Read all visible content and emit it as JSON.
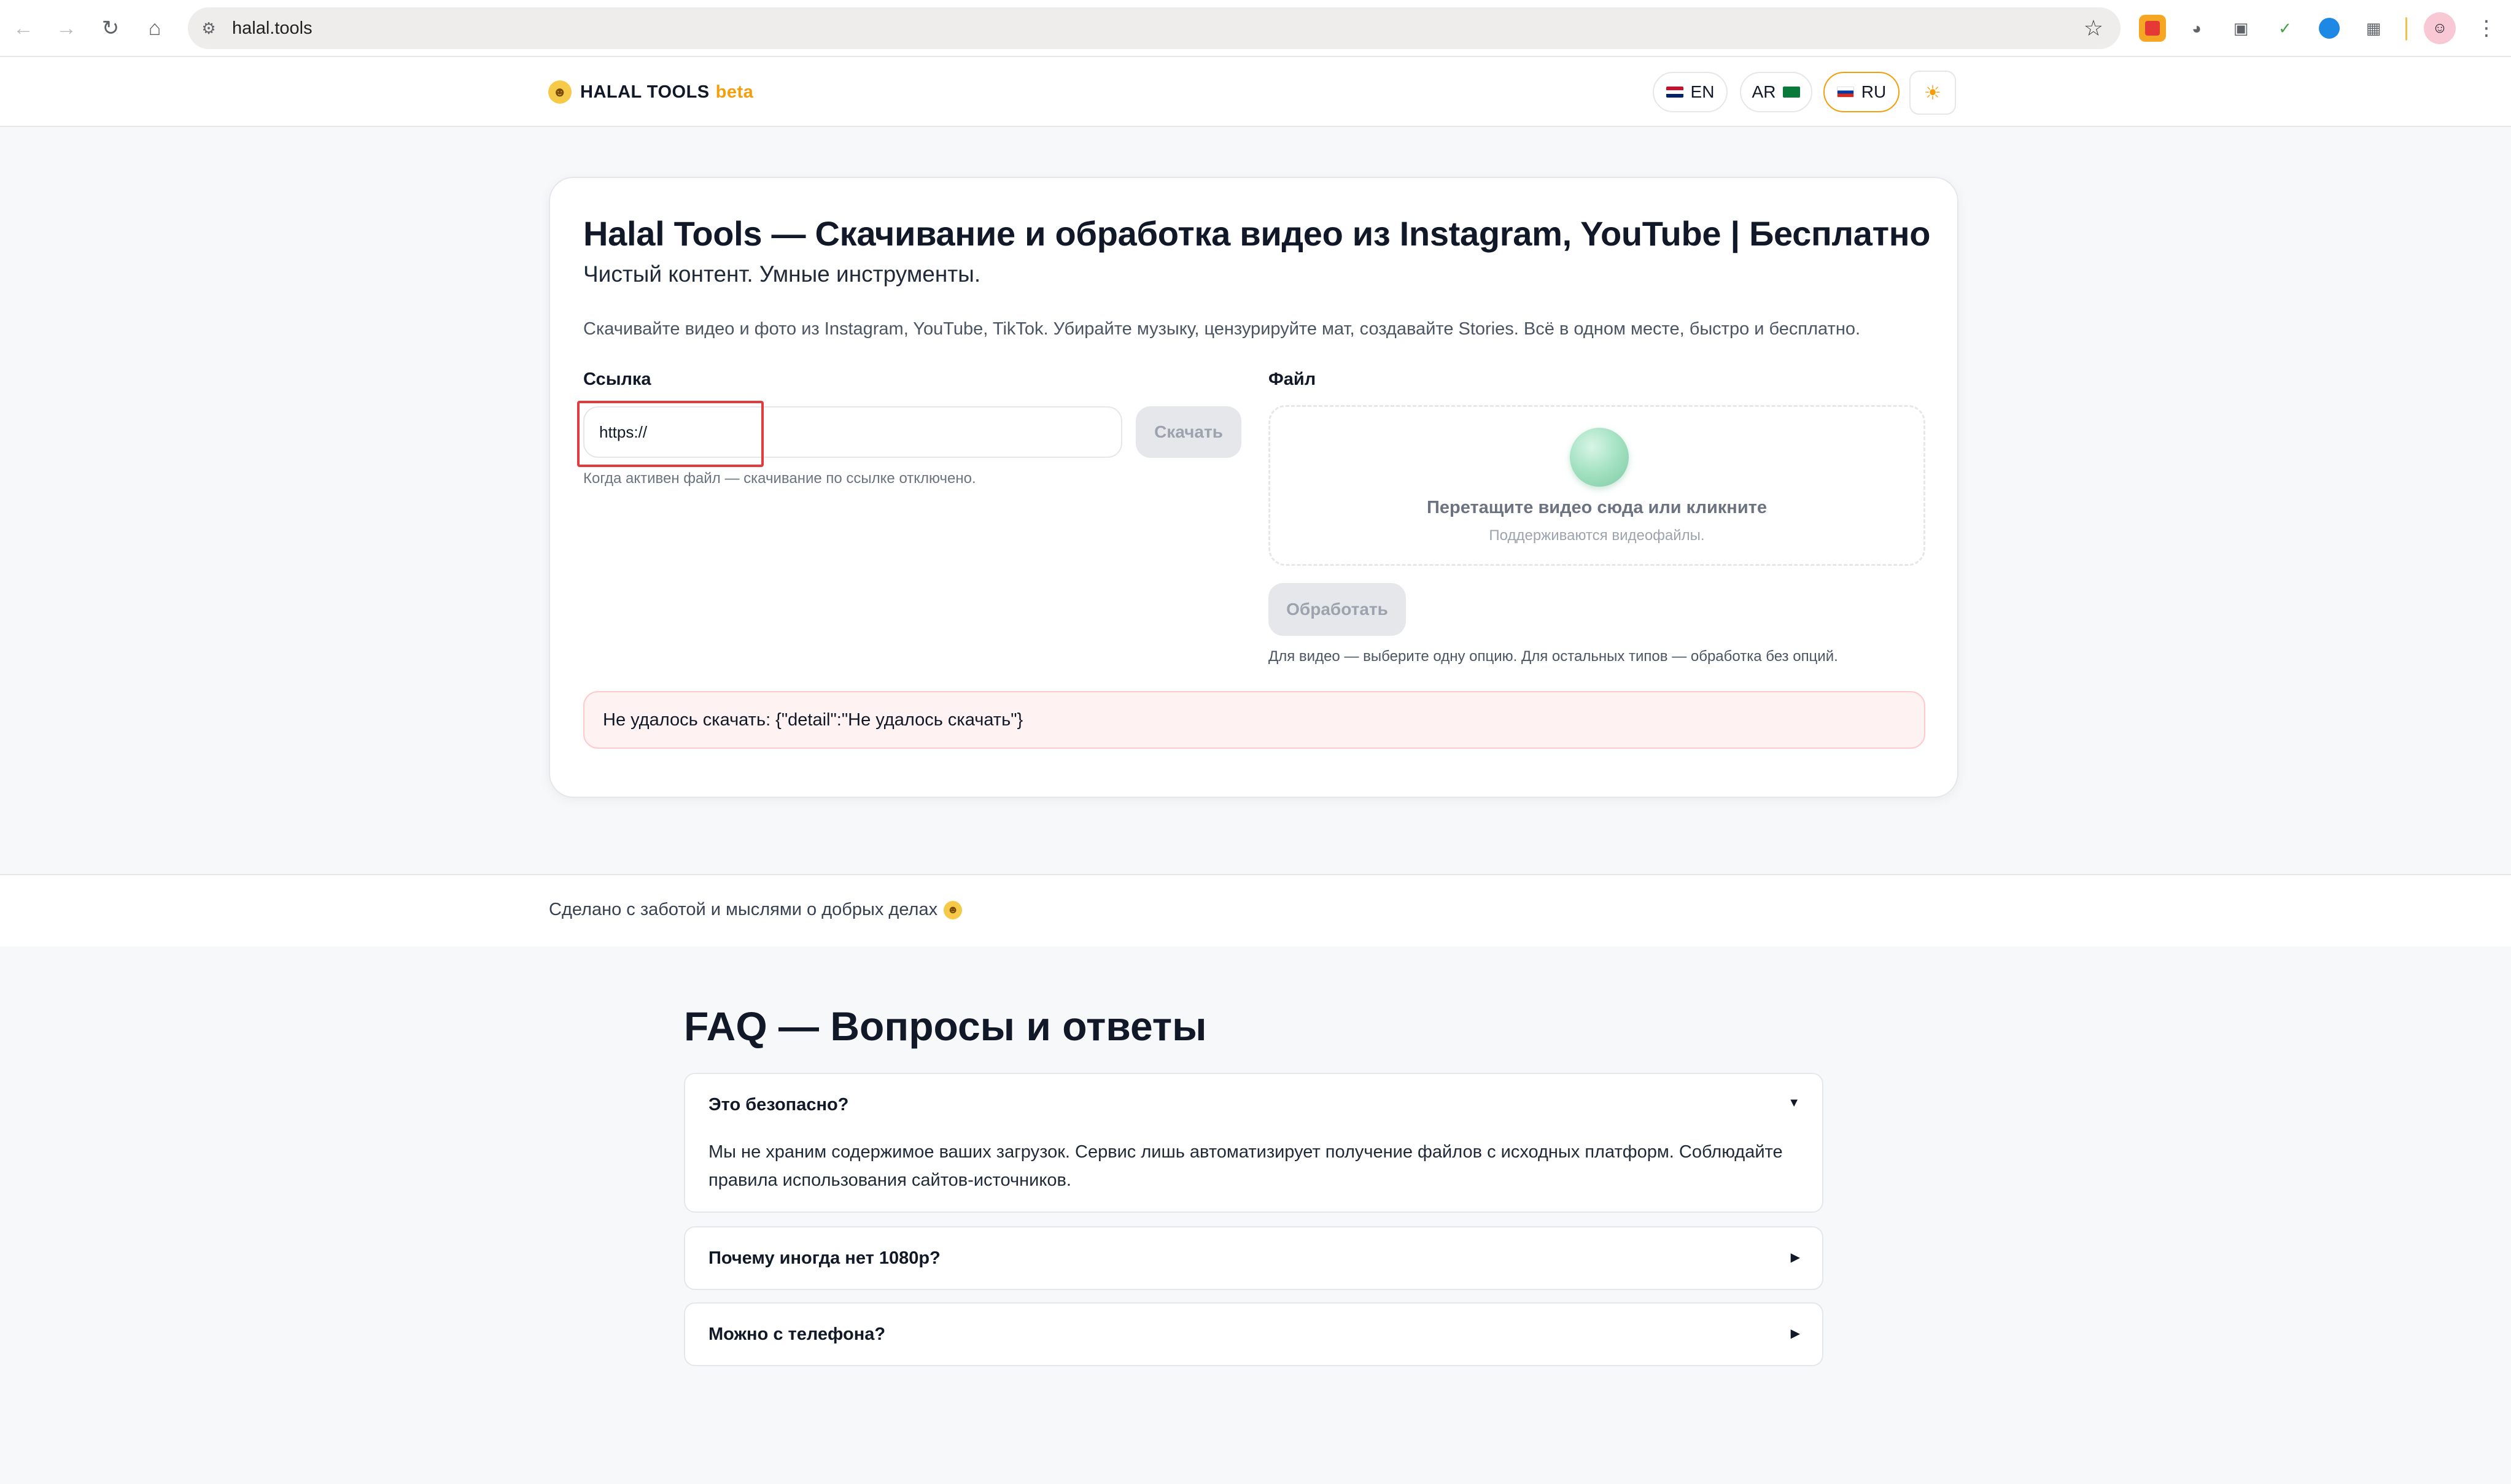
{
  "browser": {
    "url": "halal.tools"
  },
  "header": {
    "logo_text": "HALAL TOOLS",
    "logo_badge": "beta",
    "languages": [
      {
        "code": "EN",
        "active": false
      },
      {
        "code": "AR",
        "active": false
      },
      {
        "code": "RU",
        "active": true
      }
    ],
    "theme_icon": "sun-icon"
  },
  "card": {
    "title": "Halal Tools — Скачивание и обработка видео из Instagram, YouTube | Бесплатно",
    "subtitle": "Чистый контент. Умные инструменты.",
    "description": "Скачивайте видео и фото из Instagram, YouTube, TikTok. Убирайте музыку, цензурируйте мат, создавайте Stories. Всё в одном месте, быстро и бесплатно.",
    "link_label": "Ссылка",
    "link_value": "https://",
    "download_button": "Скачать",
    "link_hint": "Когда активен файл — скачивание по ссылке отключено.",
    "file_label": "Файл",
    "drop_title": "Перетащите видео сюда или кликните",
    "drop_subtitle": "Поддерживаются видеофайлы.",
    "process_button": "Обработать",
    "process_hint": "Для видео — выберите одну опцию. Для остальных типов — обработка без опций.",
    "error_message": "Не удалось скачать: {\"detail\":\"Не удалось скачать\"}"
  },
  "footer": {
    "text": "Сделано с заботой и мыслями о добрых делах"
  },
  "faq": {
    "title": "FAQ — Вопросы и ответы",
    "items": [
      {
        "question": "Это безопасно?",
        "answer": "Мы не храним содержимое ваших загрузок. Сервис лишь автоматизирует получение файлов с исходных платформ. Соблюдайте правила использования сайтов-источников.",
        "expanded": true
      },
      {
        "question": "Почему иногда нет 1080p?",
        "expanded": false
      },
      {
        "question": "Можно с телефона?",
        "expanded": false
      }
    ]
  },
  "colors": {
    "accent": "#f59e0b",
    "error_bg": "#fef2f2",
    "highlight": "#e23b3b"
  }
}
